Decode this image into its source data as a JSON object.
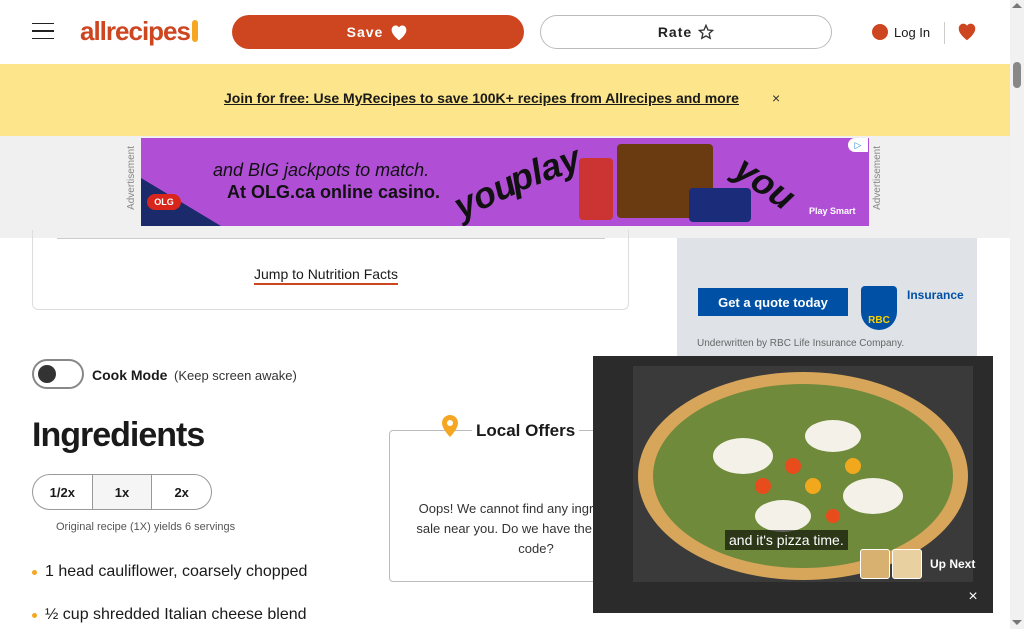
{
  "header": {
    "logo_text": "allrecipes",
    "save_label": "Save",
    "rate_label": "Rate",
    "login_label": "Log In"
  },
  "banner": {
    "link_text": "Join for free: Use MyRecipes to save 100K+ recipes from Allrecipes and more",
    "close_symbol": "×"
  },
  "top_ad": {
    "label": "Advertisement",
    "line1": "and BIG jackpots to match.",
    "line2": "At OLG.ca online casino.",
    "words": [
      "you",
      "play",
      "you"
    ],
    "brand": "OLG",
    "cta": "Play Smart",
    "color": "#b04fd6"
  },
  "recipe_card": {
    "jump_link": "Jump to Nutrition Facts"
  },
  "side_ad": {
    "button": "Get a quote today",
    "brand": "RBC",
    "product": "Insurance",
    "underwritten": "Underwritten by RBC Life Insurance Company."
  },
  "cook_mode": {
    "label": "Cook Mode",
    "sublabel": "(Keep screen awake)"
  },
  "ingredients": {
    "title": "Ingredients",
    "scale_options": [
      "1/2x",
      "1x",
      "2x"
    ],
    "scale_selected": "1x",
    "original_note": "Original recipe (1X) yields 6 servings",
    "items": [
      "1 head cauliflower, coarsely chopped",
      "½ cup shredded Italian cheese blend"
    ]
  },
  "local_offers": {
    "title": "Local Offers",
    "message": "Oops! We cannot find any ingredients on sale near you. Do we have the correct zip code?"
  },
  "video": {
    "caption": "and it's pizza time.",
    "up_next": "Up Next",
    "close_symbol": "×"
  },
  "colors": {
    "brand": "#ce4620",
    "banner": "#fce58a",
    "accent": "#f5a623"
  }
}
